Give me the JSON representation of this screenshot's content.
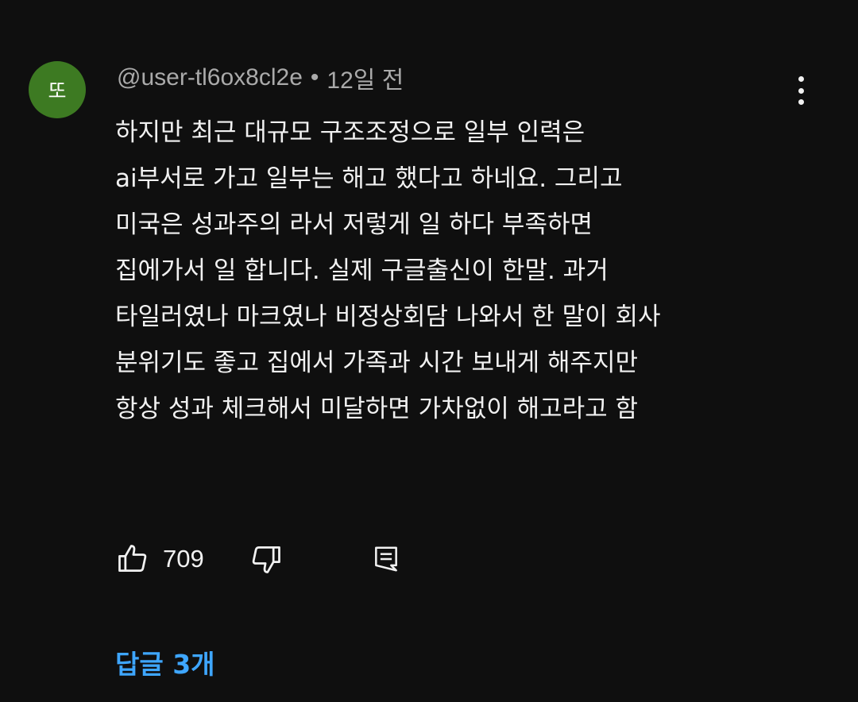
{
  "comment": {
    "avatar_letter": "또",
    "avatar_color": "#3d7a22",
    "author": "@user-tl6ox8cl2e",
    "separator": "•",
    "time": "12일 전",
    "body_lines": [
      "하지만 최근 대규모 구조조정으로 일부 인력은",
      "ai부서로 가고 일부는 해고 했다고 하네요. 그리고",
      "미국은 성과주의 라서 저렇게 일 하다 부족하면",
      "집에가서 일 합니다. 실제 구글출신이 한말. 과거",
      "타일러였나 마크였나 비정상회담 나와서 한 말이 회사",
      "분위기도 좋고 집에서 가족과 시간 보내게 해주지만",
      "항상 성과 체크해서 미달하면 가차없이 해고라고 함"
    ],
    "like_count": "709",
    "replies_label": "답글 3개",
    "replies_color": "#3ea6ff",
    "icons": {
      "more": "more-vertical-icon",
      "like": "thumbs-up-icon",
      "dislike": "thumbs-down-icon",
      "reply": "comment-reply-icon"
    }
  }
}
